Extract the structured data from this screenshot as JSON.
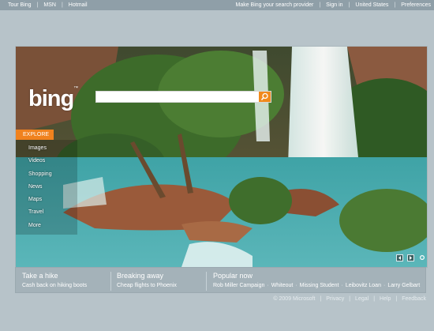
{
  "topbar": {
    "left": [
      "Tour Bing",
      "MSN",
      "Hotmail"
    ],
    "right": [
      "Make Bing your search provider",
      "Sign in",
      "United States",
      "Preferences"
    ]
  },
  "logo": {
    "text": "bing",
    "tm": "™"
  },
  "search": {
    "value": "",
    "placeholder": ""
  },
  "explore": "EXPLORE",
  "nav": [
    "Images",
    "Videos",
    "Shopping",
    "News",
    "Maps",
    "Travel",
    "More"
  ],
  "panel": {
    "col1": {
      "head": "Take a hike",
      "sub": "Cash back on hiking boots"
    },
    "col2": {
      "head": "Breaking away",
      "sub": "Cheap flights to Phoenix"
    },
    "col3": {
      "head": "Popular now",
      "items": [
        "Rob Miller Campaign",
        "Whiteout",
        "Missing Student",
        "Leibovitz Loan",
        "Larry Gelbart"
      ]
    }
  },
  "footer": [
    "© 2009 Microsoft",
    "Privacy",
    "Legal",
    "Help",
    "Feedback"
  ],
  "colors": {
    "accent": "#f08a1c",
    "bar": "#8f9fa8",
    "page": "#b7c3c9"
  }
}
